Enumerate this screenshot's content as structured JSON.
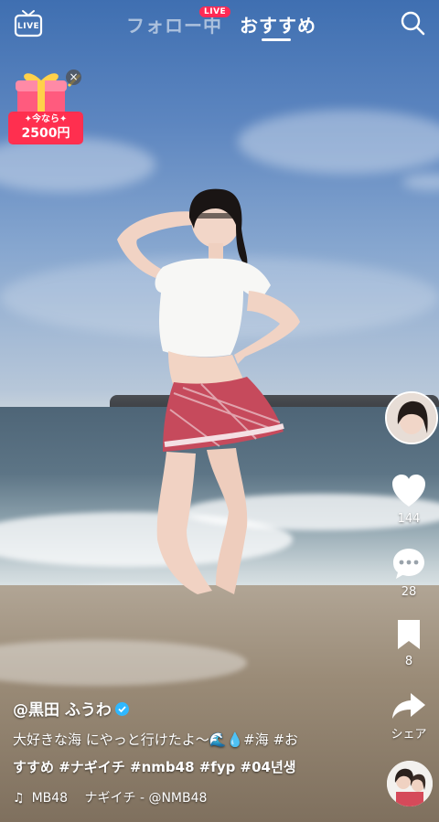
{
  "header": {
    "live_label": "LIVE",
    "tab_following": "フォロー中",
    "tab_recommended": "おすすめ",
    "live_badge": "LIVE"
  },
  "promo": {
    "line1": "✦今なら✦",
    "price": "2500円",
    "close": "×"
  },
  "actions": {
    "likes": "144",
    "comments": "28",
    "saves": "8",
    "share": "シェア"
  },
  "post": {
    "username": "@黒田 ふうわ",
    "caption_line1": "大好きな海 にやっと行けたよ〜🌊💧#海 #お",
    "caption_line2": "すすめ #ナギイチ #nmb48 #fyp #04년생",
    "music": "MB48　 ナギイチ - @NMB48"
  },
  "colors": {
    "accent_red": "#ff2a55",
    "verified_blue": "#2fb8ff"
  }
}
